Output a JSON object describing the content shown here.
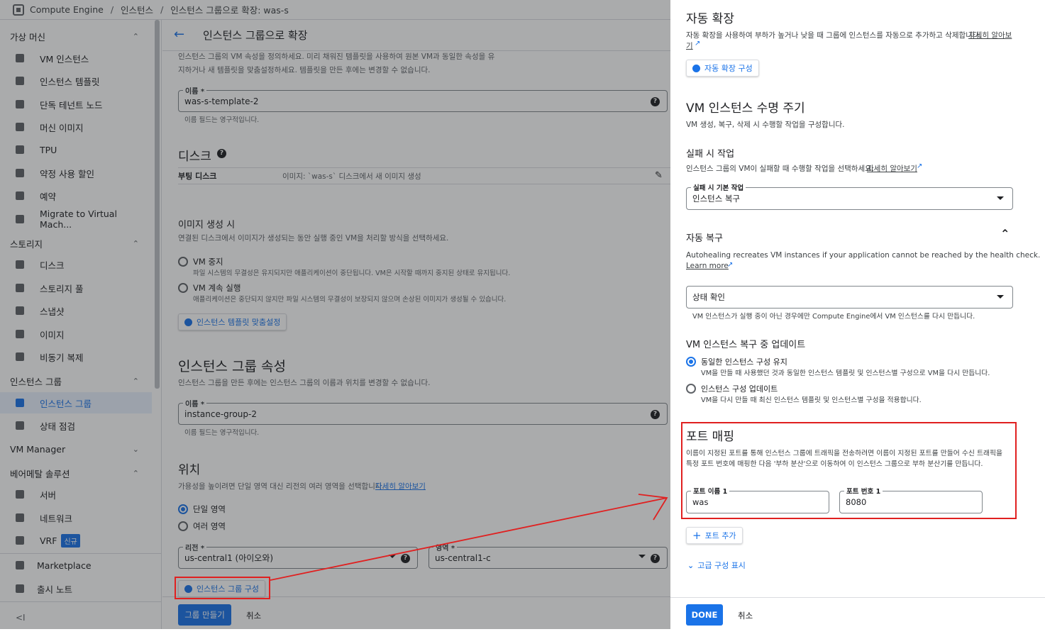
{
  "breadcrumb": {
    "product": "Compute Engine",
    "section": "인스턴스",
    "page": "인스턴스 그룹으로 확장: was-s"
  },
  "sidebar": {
    "groups": [
      {
        "label": "가상 머신",
        "chevron": "up",
        "items": [
          {
            "label": "VM 인스턴스"
          },
          {
            "label": "인스턴스 템플릿"
          },
          {
            "label": "단독 테넌트 노드"
          },
          {
            "label": "머신 이미지"
          },
          {
            "label": "TPU"
          },
          {
            "label": "약정 사용 할인"
          },
          {
            "label": "예약"
          },
          {
            "label": "Migrate to Virtual Mach..."
          }
        ]
      },
      {
        "label": "스토리지",
        "chevron": "up",
        "items": [
          {
            "label": "디스크"
          },
          {
            "label": "스토리지 풀"
          },
          {
            "label": "스냅샷"
          },
          {
            "label": "이미지"
          },
          {
            "label": "비동기 복제"
          }
        ]
      },
      {
        "label": "인스턴스 그룹",
        "chevron": "up",
        "items": [
          {
            "label": "인스턴스 그룹",
            "active": true
          },
          {
            "label": "상태 점검"
          }
        ]
      },
      {
        "label": "VM Manager",
        "chevron": "down",
        "items": []
      },
      {
        "label": "베어메탈 솔루션",
        "chevron": "up",
        "items": [
          {
            "label": "서버"
          },
          {
            "label": "네트워크"
          },
          {
            "label": "VRF",
            "badge": "신규"
          }
        ]
      }
    ],
    "marketplace": "Marketplace",
    "release_notes": "출시 노트",
    "collapse": "<I"
  },
  "main": {
    "title": "인스턴스 그룹으로 확장",
    "intro": [
      "인스턴스 그룹의 VM 속성을 정의하세요. 미리 채워진 템플릿을 사용하여 원본 VM과 동일한 속성을 유",
      "지하거나 새 템플릿을 맞춤설정하세요. 템플릿을 만든 후에는 변경할 수 없습니다."
    ],
    "name_label": "이름 *",
    "name_value": "was-s-template-2",
    "name_hint": "이름 필드는 영구적입니다.",
    "disk_title": "디스크",
    "boot_disk_label": "부팅 디스크",
    "boot_disk_value": "이미지: `was-s` 디스크에서 새 이미지 생성",
    "image_create_title": "이미지 생성 시",
    "image_create_desc": "연결된 디스크에서 이미지가 생성되는 동안 실행 중인 VM을 처리할 방식을 선택하세요.",
    "vm_stop": "VM 중지",
    "vm_stop_desc": "파일 시스템의 무결성은 유지되지만 애플리케이션이 중단됩니다. VM은 시작할 때까지 중지된 상태로 유지됩니다.",
    "vm_continue": "VM 계속 실행",
    "vm_continue_desc": "애플리케이션은 중단되지 않지만 파일 시스템의 무결성이 보장되지 않으며 손상된 이미지가 생성될 수 있습니다.",
    "customize_template_btn": "인스턴스 템플릿 맞춤설정",
    "group_props_title": "인스턴스 그룹 속성",
    "group_props_desc": "인스턴스 그룹을 만든 후에는 인스턴스 그룹의 이름과 위치를 변경할 수 없습니다.",
    "group_name_label": "이름 *",
    "group_name_value": "instance-group-2",
    "group_name_hint": "이름 필드는 영구적입니다.",
    "location_title": "위치",
    "location_desc": "가용성을 높이려면 단일 영역 대신 리전의 여러 영역을 선택합니다.",
    "location_link": "자세히 알아보기",
    "single_zone": "단일 영역",
    "multi_zone": "여러 영역",
    "region_label": "리전 *",
    "region_value": "us-central1 (아이오와)",
    "zone_label": "영역 *",
    "zone_value": "us-central1-c",
    "configure_group_btn": "인스턴스 그룹 구성",
    "create_btn": "그룹 만들기",
    "cancel_btn": "취소"
  },
  "panel": {
    "autoscale_title": "자동 확장",
    "autoscale_desc": "자동 확장을 사용하여 부하가 높거나 낮을 때 그룹에 인스턴스를 자동으로 추가하고 삭제합니다.",
    "autoscale_link_a": "자세히 알아보",
    "autoscale_link_b": "기",
    "autoscale_btn": "자동 확장 구성",
    "lifecycle_title": "VM 인스턴스 수명 주기",
    "lifecycle_desc": "VM 생성, 복구, 삭제 시 수행할 작업을 구성합니다.",
    "fail_title": "실패 시 작업",
    "fail_desc": "인스턴스 그룹의 VM이 실패할 때 수행할 작업을 선택하세요.",
    "fail_link": "자세히 알아보기",
    "fail_default_label": "실패 시 기본 작업",
    "fail_default_value": "인스턴스 복구",
    "autoheal_title": "자동 복구",
    "autoheal_desc": "Autohealing recreates VM instances if your application cannot be reached by the health check.",
    "autoheal_link": "Learn more",
    "health_check_value": "상태 확인",
    "health_check_hint": "VM 인스턴스가 실행 중이 아닌 경우에만 Compute Engine에서 VM 인스턴스를 다시 만듭니다.",
    "repair_update_title": "VM 인스턴스 복구 중 업데이트",
    "keep_config": "동일한 인스턴스 구성 유지",
    "keep_config_desc": "VM을 만들 때 사용했던 것과 동일한 인스턴스 템플릿 및 인스턴스별 구성으로 VM을 다시 만듭니다.",
    "update_config": "인스턴스 구성 업데이트",
    "update_config_desc": "VM을 다시 만들 때 최신 인스턴스 템플릿 및 인스턴스별 구성을 적용합니다.",
    "port_mapping_title": "포트 매핑",
    "port_mapping_desc": [
      "이름이 지정된 포트를 통해 인스턴스 그룹에 트래픽을 전송하려면 이름이 지정된 포트를 만들어 수신 트래픽을",
      "특정 포트 번호에 매핑한 다음 '부하 분산'으로 이동하여 이 인스턴스 그룹으로 부하 분산기를 만듭니다."
    ],
    "port_name_label": "포트 이름 1",
    "port_name_value": "was",
    "port_number_label": "포트 번호 1",
    "port_number_value": "8080",
    "add_port_btn": "포트 추가",
    "advanced_toggle": "고급 구성 표시",
    "done_btn": "DONE",
    "cancel_btn": "취소"
  },
  "annotation": {
    "highlight_color": "#e02020"
  }
}
